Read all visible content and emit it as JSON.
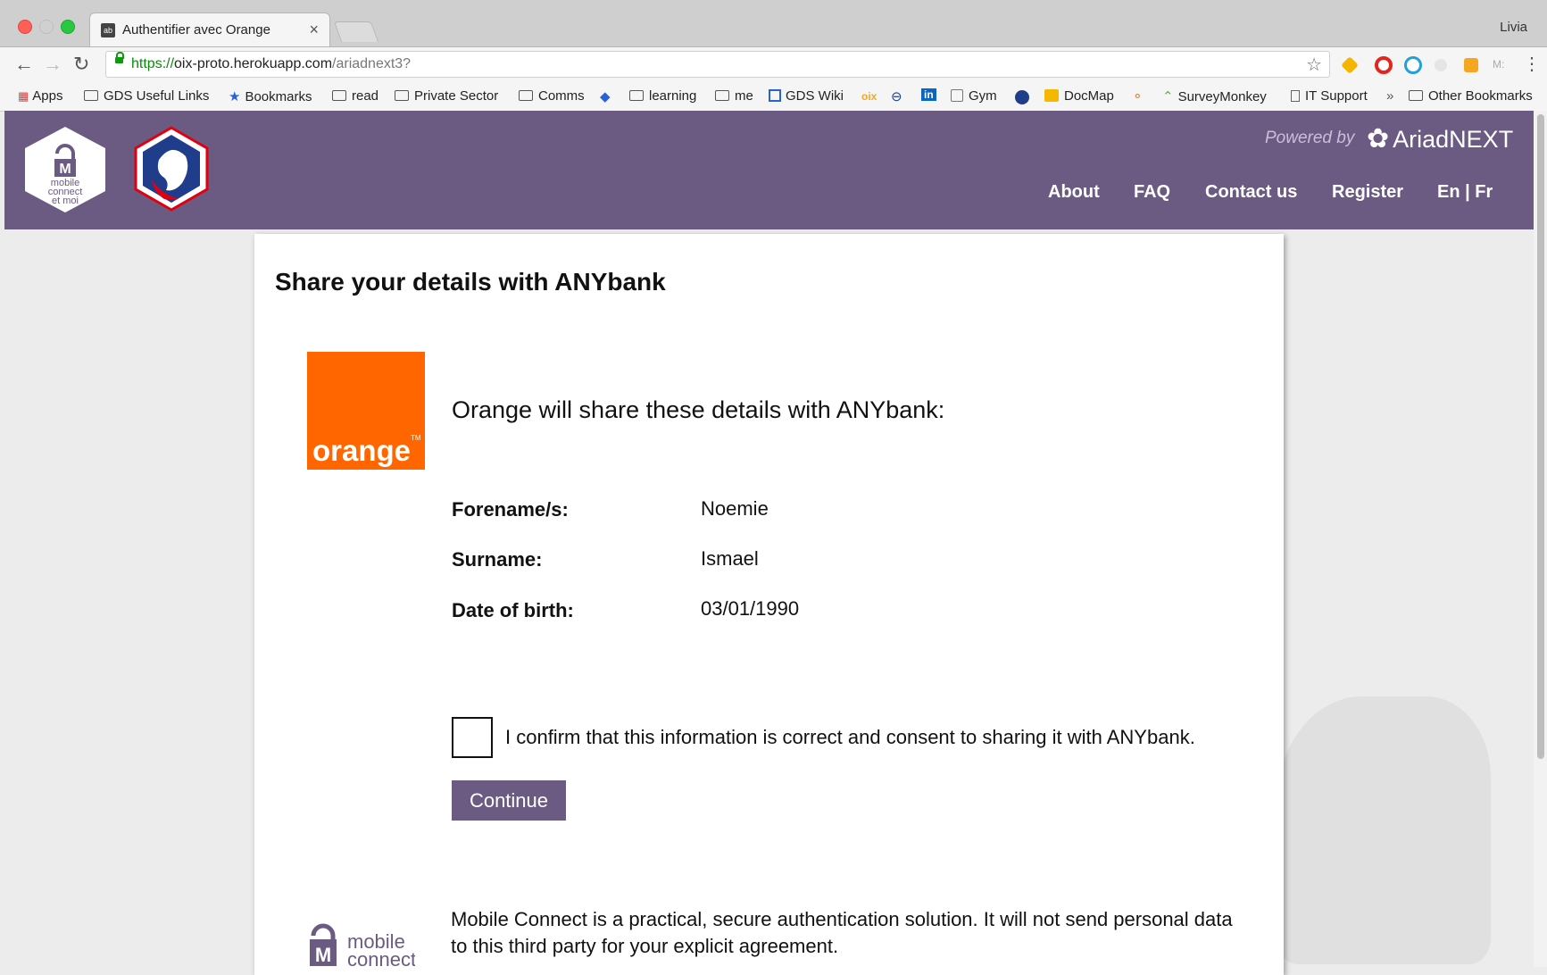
{
  "browser": {
    "tab_title": "Authentifier avec Orange",
    "tab_close": "×",
    "tab_favicon": "ab",
    "profile_name": "Livia",
    "url_scheme": "https://",
    "url_host": "oix-proto.herokuapp.com",
    "url_path": "/ariadnext3?",
    "bookmarks": [
      {
        "label": "Apps",
        "icon": "apps-grid-icon"
      },
      {
        "label": "GDS Useful Links",
        "icon": "folder-icon"
      },
      {
        "label": "Bookmarks",
        "icon": "star-icon"
      },
      {
        "label": "read",
        "icon": "folder-icon"
      },
      {
        "label": "Private Sector",
        "icon": "folder-icon"
      },
      {
        "label": "Comms",
        "icon": "folder-icon"
      },
      {
        "label": "learning",
        "icon": "folder-icon"
      },
      {
        "label": "me",
        "icon": "folder-icon"
      },
      {
        "label": "GDS Wiki",
        "icon": "wiki-icon"
      },
      {
        "label": "oix",
        "icon": "oix-icon"
      },
      {
        "label": "Gym",
        "icon": "gym-icon"
      },
      {
        "label": "DocMap",
        "icon": "docmap-icon"
      },
      {
        "label": "SurveyMonkey",
        "icon": "surveymonkey-icon"
      },
      {
        "label": "IT Support",
        "icon": "page-icon"
      },
      {
        "label": "»",
        "icon": "more-icon"
      },
      {
        "label": "Other Bookmarks",
        "icon": "folder-icon"
      }
    ]
  },
  "header": {
    "mc_badge": [
      "mobile",
      "connect",
      "et moi"
    ],
    "powered_by": "Powered by",
    "brand": "AriadNEXT",
    "nav": [
      "About",
      "FAQ",
      "Contact us",
      "Register",
      "En | Fr"
    ]
  },
  "card": {
    "title": "Share your details with ANYbank",
    "orange_logo_text": "orange",
    "orange_tm": "TM",
    "share_heading": "Orange will share these details with ANYbank:",
    "details": [
      {
        "label": "Forename/s:",
        "value": "Noemie"
      },
      {
        "label": "Surname:",
        "value": "Ismael"
      },
      {
        "label": "Date of birth:",
        "value": "03/01/1990"
      }
    ],
    "consent_text": "I confirm that this information is correct and consent to sharing it with ANYbank.",
    "consent_checked": false,
    "continue_label": "Continue",
    "mc_logo_text": [
      "mobile",
      "connect"
    ],
    "mc_description": "Mobile Connect is a practical, secure authentication solution. It will not send personal data to this third party for your explicit agreement."
  },
  "colors": {
    "header_purple": "#6b5b82",
    "orange": "#ff6600",
    "button_purple": "#6b5b82"
  }
}
